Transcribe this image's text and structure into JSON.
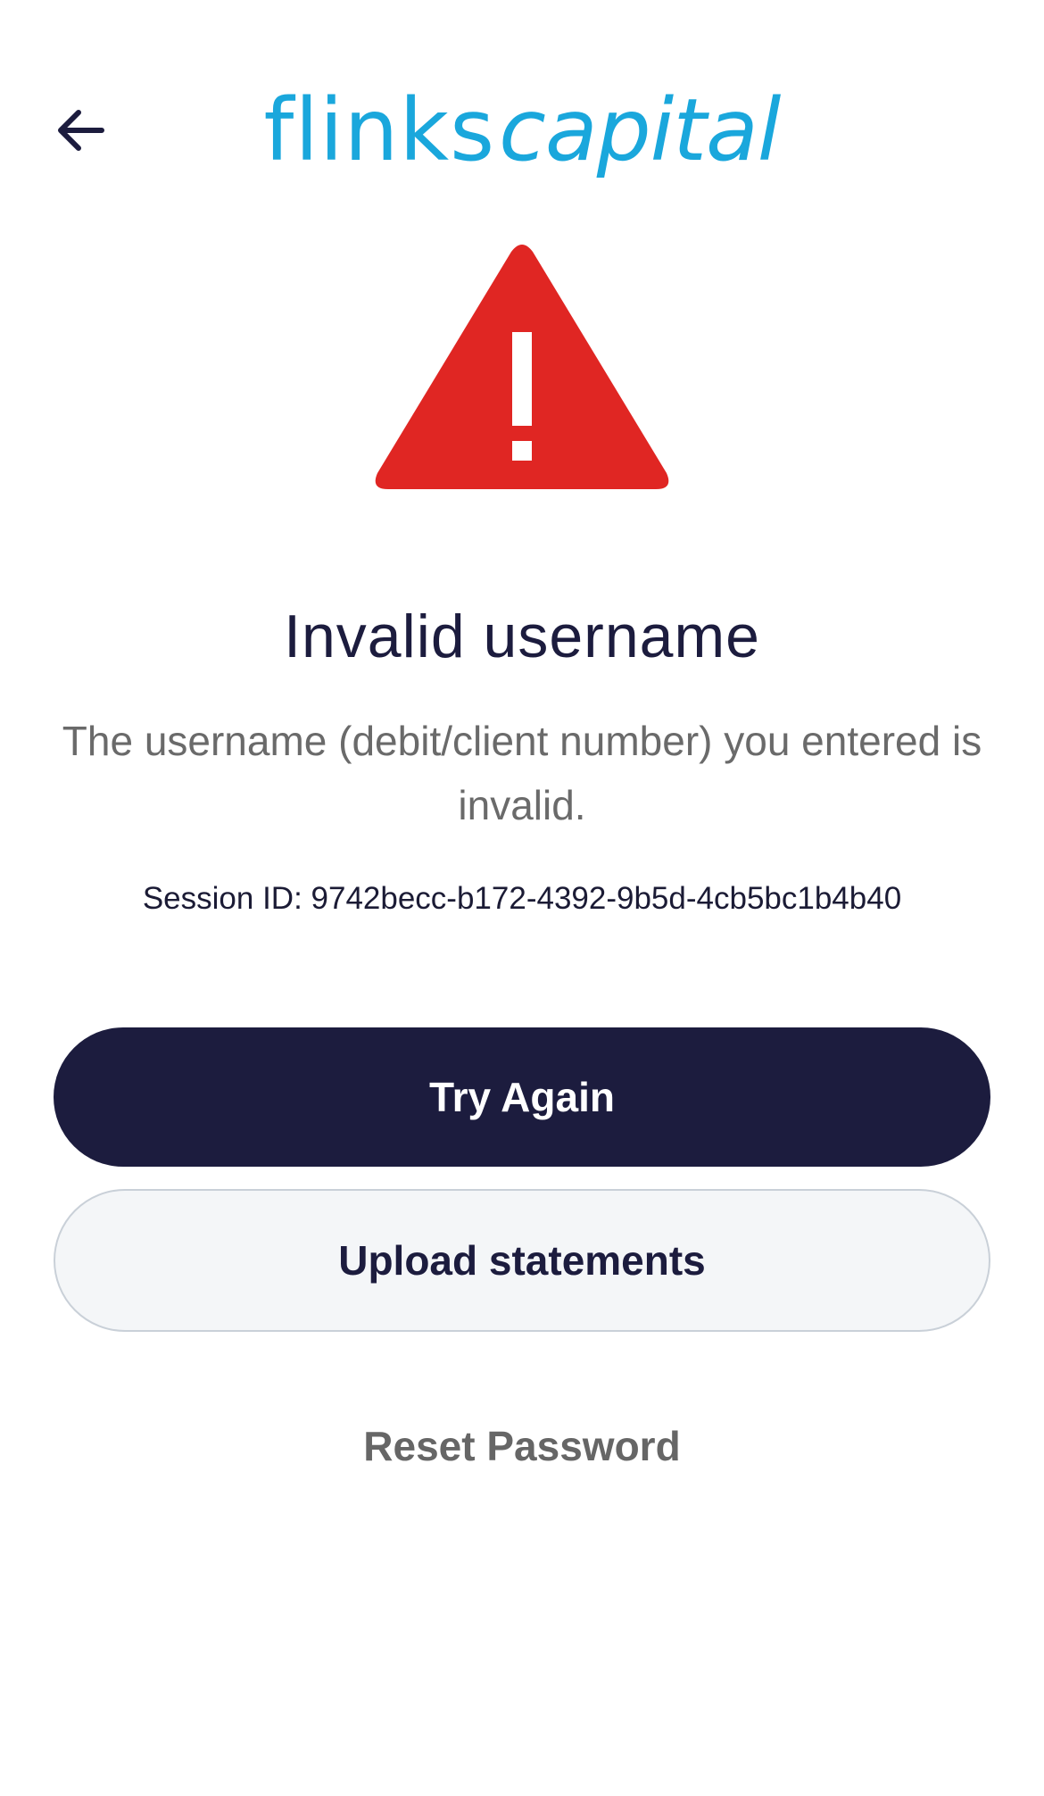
{
  "header": {
    "back_icon": "arrow-left-icon",
    "logo_part1": "flinks",
    "logo_part2": "capital",
    "brand_color": "#1aa7dc"
  },
  "alert": {
    "icon": "warning-triangle-icon",
    "icon_color": "#e02623",
    "title": "Invalid username",
    "message": "The username (debit/client number) you entered is invalid.",
    "session_id": "Session ID: 9742becc-b172-4392-9b5d-4cb5bc1b4b40"
  },
  "actions": {
    "try_again_label": "Try Again",
    "upload_label": "Upload statements",
    "reset_label": "Reset Password",
    "primary_color": "#1c1c3e"
  }
}
